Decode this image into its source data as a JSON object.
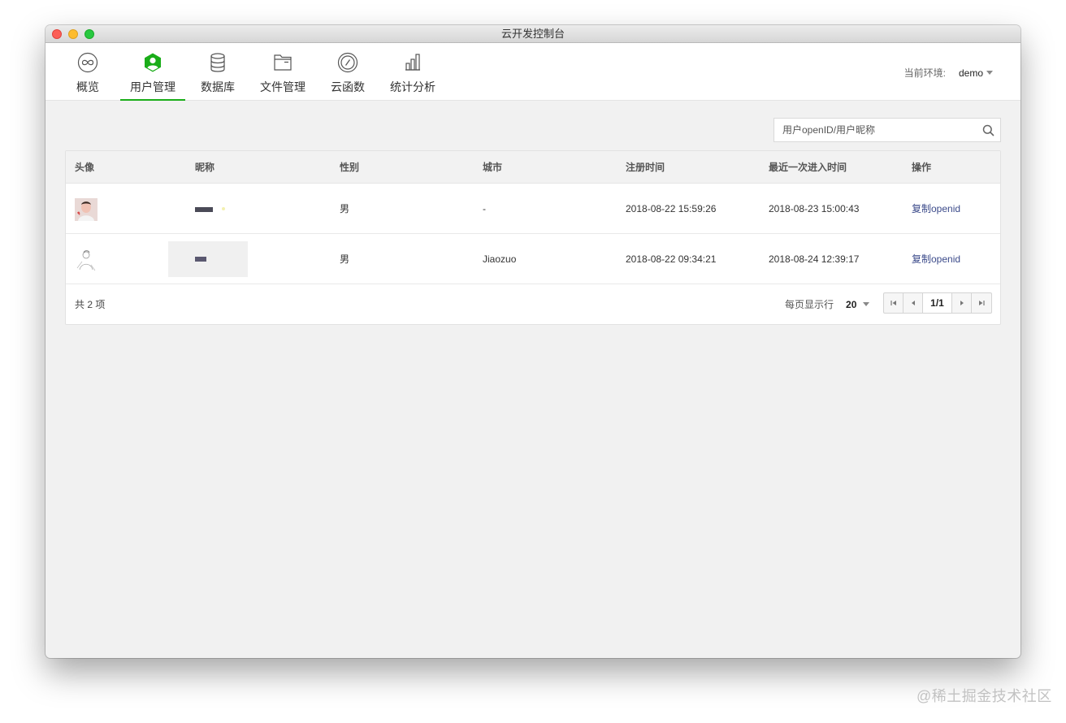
{
  "window": {
    "title": "云开发控制台"
  },
  "nav": {
    "items": [
      {
        "label": "概览",
        "icon": "overview-icon",
        "active": false
      },
      {
        "label": "用户管理",
        "icon": "user-management-icon",
        "active": true
      },
      {
        "label": "数据库",
        "icon": "database-icon",
        "active": false
      },
      {
        "label": "文件管理",
        "icon": "folder-icon",
        "active": false
      },
      {
        "label": "云函数",
        "icon": "cloud-function-icon",
        "active": false
      },
      {
        "label": "统计分析",
        "icon": "stats-icon",
        "active": false
      }
    ],
    "env_label": "当前环境:",
    "env_value": "demo"
  },
  "colors": {
    "accent": "#1aad19",
    "link": "#3b4a8a"
  },
  "search": {
    "placeholder": "用户openID/用户昵称"
  },
  "table": {
    "columns": [
      "头像",
      "昵称",
      "性别",
      "城市",
      "注册时间",
      "最近一次进入时间",
      "操作"
    ],
    "rows": [
      {
        "gender": "男",
        "city": "-",
        "registered": "2018-08-22 15:59:26",
        "last_visit": "2018-08-23 15:00:43",
        "action": "复制openid"
      },
      {
        "gender": "男",
        "city": "Jiaozuo",
        "registered": "2018-08-22 09:34:21",
        "last_visit": "2018-08-24 12:39:17",
        "action": "复制openid"
      }
    ]
  },
  "footer": {
    "total": "共 2 项",
    "per_page_label": "每页显示行",
    "per_page_value": "20",
    "page": "1/1"
  },
  "watermark": "@稀土掘金技术社区"
}
